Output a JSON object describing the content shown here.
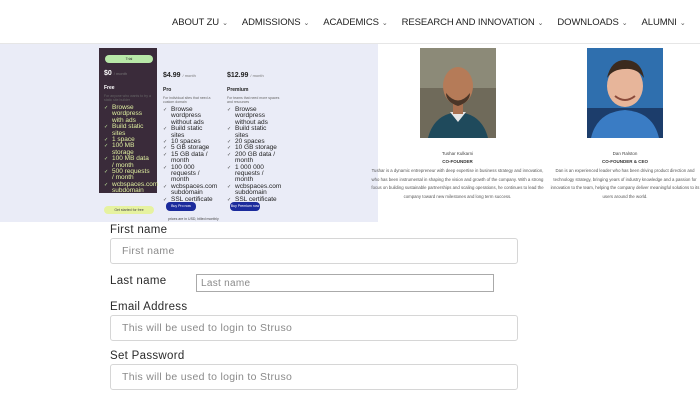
{
  "nav": {
    "items": [
      "ABOUT ZU",
      "ADMISSIONS",
      "ACADEMICS",
      "RESEARCH AND INNOVATION",
      "DOWNLOADS",
      "ALUMNI"
    ]
  },
  "pricing": {
    "free": {
      "badge": "Trial",
      "price": "$0",
      "period": "/ month",
      "name": "Free",
      "desc": "For anyone who wants to try a static site builder",
      "features": [
        "Browse wordpress with ads",
        "Build static sites",
        "1 space",
        "100 MB storage",
        "100 MB data / month",
        "500 requests / month",
        "wcbspaces.com subdomain"
      ],
      "button": "Get started for free"
    },
    "pro": {
      "price": "$4.99",
      "period": "/ month",
      "name": "Pro",
      "desc": "For individual sites that need a custom domain",
      "features": [
        "Browse wordpress without ads",
        "Build static sites",
        "10 spaces",
        "5 GB storage",
        "15 GB data / month",
        "100 000 requests / month",
        "wcbspaces.com subdomain",
        "SSL certificate"
      ],
      "button": "Buy Pro now"
    },
    "premium": {
      "price": "$12.99",
      "period": "/ month",
      "name": "Premium",
      "desc": "For teams that need more spaces and resources",
      "features": [
        "Browse wordpress without ads",
        "Build static sites",
        "20 spaces",
        "10 GB storage",
        "200 GB data / month",
        "1 000 000 requests / month",
        "wcbspaces.com subdomain",
        "SSL certificate"
      ],
      "button": "Buy Premium now"
    },
    "footnote": "prices are in USD, billed monthly"
  },
  "founders": [
    {
      "name": "Tushar Kulkarni",
      "role": "CO-FOUNDER",
      "bio": "Tushar is a dynamic entrepreneur with deep expertise in business strategy and innovation, who has been instrumental in shaping the vision and growth of the company. With a strong focus on building sustainable partnerships and scaling operations, he continues to lead the company toward new milestones and long term success."
    },
    {
      "name": "Dan Ralston",
      "role": "CO-FOUNDER & CEO",
      "bio": "Dan is an experienced leader who has been driving product direction and technology strategy, bringing years of industry knowledge and a passion for innovation to the team, helping the company deliver meaningful solutions to its users around the world."
    }
  ],
  "form": {
    "first_name_label": "First name",
    "first_name_placeholder": "First name",
    "last_name_label": "Last name",
    "last_name_placeholder": "Last name",
    "email_label": "Email Address",
    "email_placeholder": "This will be used to login to Struso",
    "password_label": "Set Password",
    "password_placeholder": "This will be used to login to Struso"
  }
}
